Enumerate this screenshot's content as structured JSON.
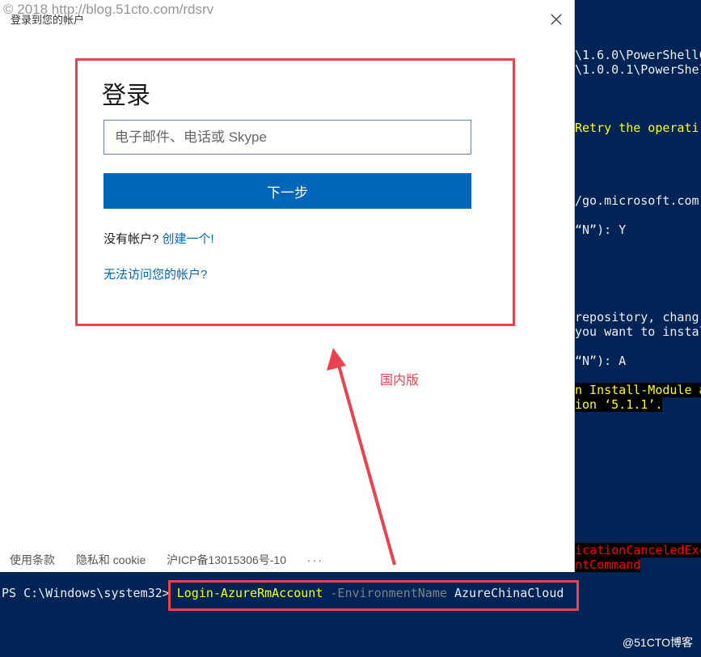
{
  "console": {
    "lines_right": [
      {
        "text": "\\1.6.0\\PowerShellC",
        "style": "normal"
      },
      {
        "text": "\\1.0.0.1\\PowerShel",
        "style": "normal"
      },
      {
        "text": "Retry the operati",
        "style": "yellow"
      },
      {
        "text": "/go.microsoft.com",
        "style": "normal"
      },
      {
        "text": "“N”): Y",
        "style": "normal"
      },
      {
        "text": "repository, chang",
        "style": "normal"
      },
      {
        "text": "you want to instal",
        "style": "normal"
      },
      {
        "text": "“N”): A",
        "style": "normal"
      },
      {
        "text": "n Install-Module a",
        "style": "warn"
      },
      {
        "text": "ion ‘5.1.1’.",
        "style": "warn"
      },
      {
        "text": "icationCanceledExc",
        "style": "err"
      },
      {
        "text": "ntCommand",
        "style": "err"
      }
    ],
    "prompt": "PS C:\\Windows\\system32>",
    "command": "Login-AzureRmAccount",
    "param": "-EnvironmentName",
    "arg": "AzureChinaCloud",
    "watermark_bottom": "@51CTO博客"
  },
  "dialog": {
    "title": "登录到您的帐户",
    "watermark_top": "© 2018 http://blog.51cto.com/rdsrv",
    "close_icon": "✕",
    "heading": "登录",
    "email_placeholder": "电子邮件、电话或 Skype",
    "next_label": "下一步",
    "no_account_text": "没有帐户?",
    "create_link": "创建一个!",
    "cant_access_link": "无法访问您的帐户?",
    "footer": {
      "terms": "使用条款",
      "privacy": "隐私和 cookie",
      "icp": "沪ICP备13015306号-10",
      "more": "···"
    }
  },
  "annotation": {
    "label": "国内版",
    "color": "#e8434e"
  },
  "colors": {
    "console_bg": "#012456",
    "accent": "#0067b8",
    "highlight": "#e8434e"
  }
}
